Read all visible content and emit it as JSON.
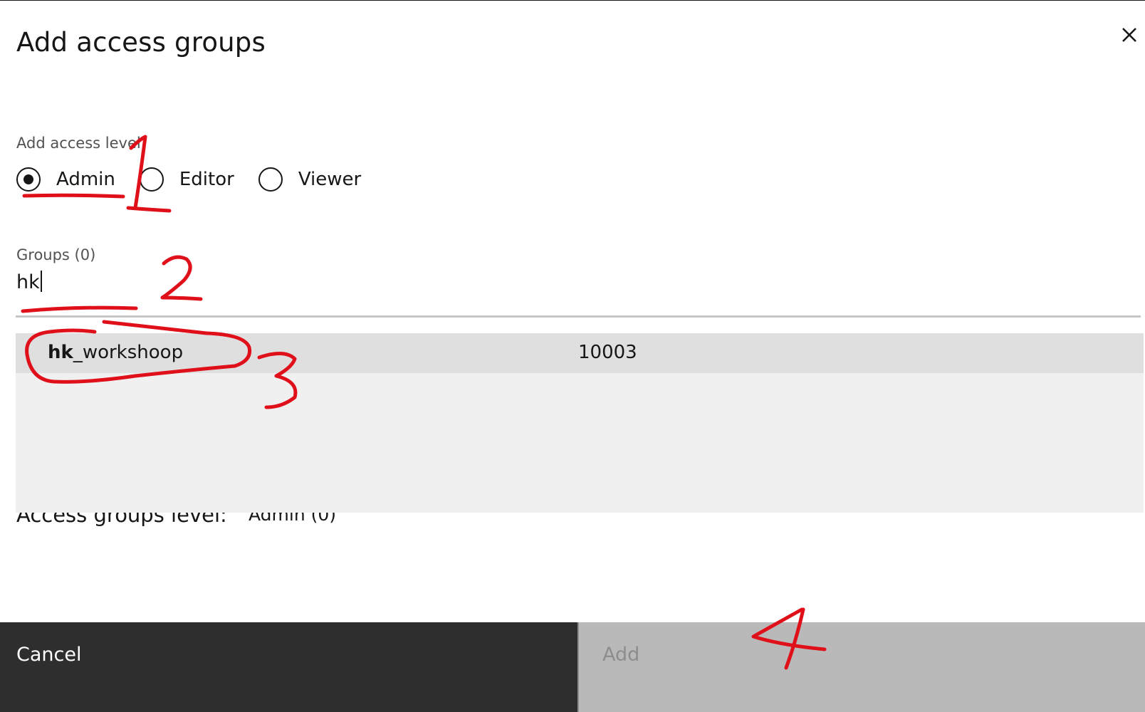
{
  "modal": {
    "title": "Add access groups",
    "close_icon": "close-icon"
  },
  "access_level": {
    "label": "Add access level",
    "options": [
      {
        "label": "Admin",
        "checked": true
      },
      {
        "label": "Editor",
        "checked": false
      },
      {
        "label": "Viewer",
        "checked": false
      }
    ]
  },
  "groups": {
    "label": "Groups (0)",
    "search_value": "hk",
    "results": [
      {
        "match": "hk",
        "rest": "_workshoop",
        "id": "10003"
      }
    ]
  },
  "summary": {
    "label": "Access groups level:",
    "value": "Admin (0)"
  },
  "footer": {
    "cancel_label": "Cancel",
    "add_label": "Add",
    "add_enabled": false
  },
  "annotations": {
    "color": "#e0101a",
    "marks": [
      "1",
      "2",
      "3",
      "4"
    ]
  }
}
